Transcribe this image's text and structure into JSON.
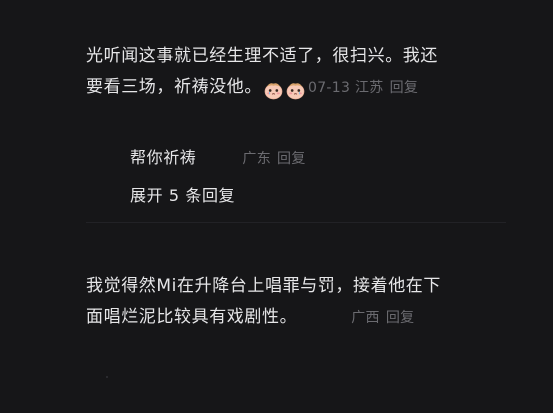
{
  "comments": [
    {
      "text_line1": "光听闻这事就已经生理不适了，很扫兴。我还",
      "text_line2": "要看三场，祈祷没他。",
      "emoji": [
        "tearful-face-icon",
        "tearful-face-icon"
      ],
      "date": "07-13",
      "location": "江苏",
      "reply_label": "回复",
      "sub_replies": [
        {
          "text": "帮你祈祷",
          "location": "广东",
          "reply_label": "回复"
        }
      ],
      "expand_label": "展开 5 条回复"
    },
    {
      "text_line1": "我觉得然Mi在升降台上唱罪与罚，接着他在下",
      "text_line2": "面唱烂泥比较具有戏剧性。",
      "location": "广西",
      "reply_label": "回复"
    }
  ],
  "colors": {
    "background": "#161618",
    "text": "#e6e6e8",
    "meta": "#6b6b70"
  }
}
